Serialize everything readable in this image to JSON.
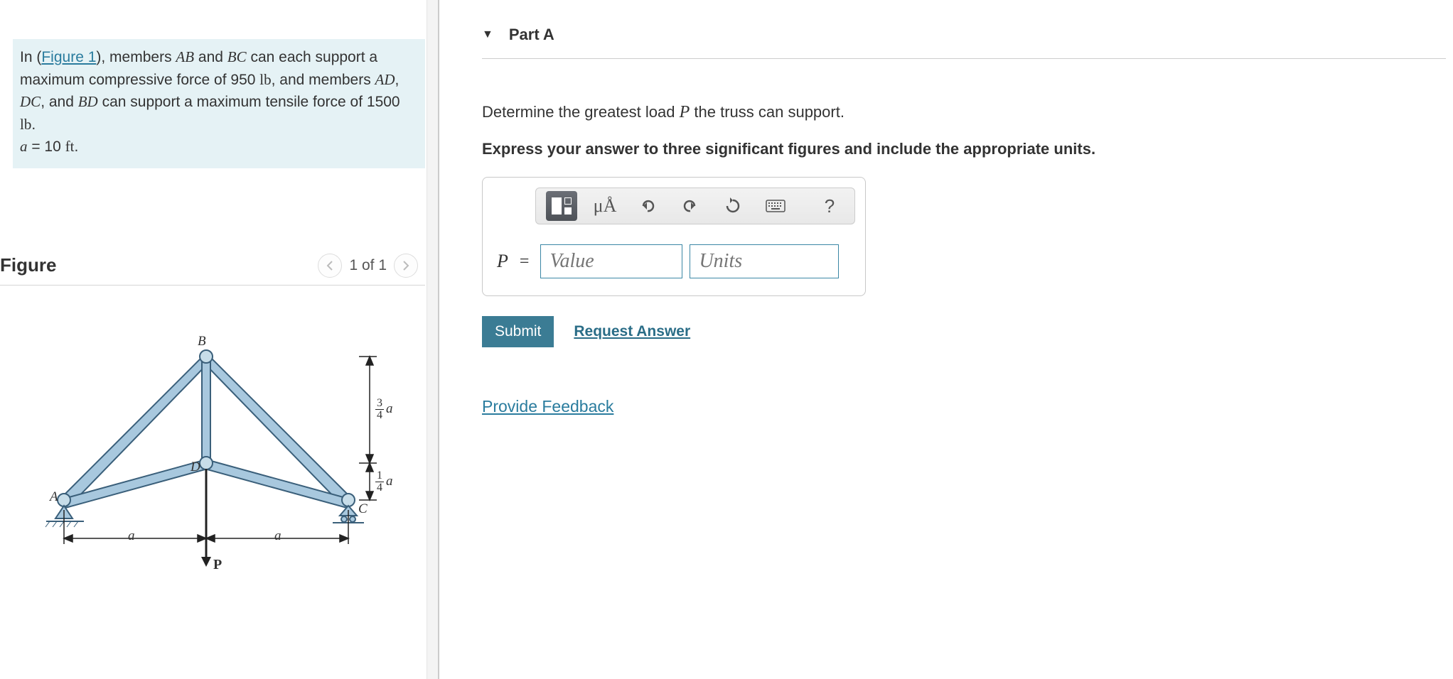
{
  "problem": {
    "prefix": "In (",
    "figure_link": "Figure 1",
    "text_after_link": "), members ",
    "m1": "AB",
    "t2": " and ",
    "m2": "BC",
    "t3": " can each support a maximum compressive force of 950 ",
    "unit1": "lb",
    "t4": ", and members ",
    "m3": "AD",
    "t5": ", ",
    "m4": "DC",
    "t6": ", and ",
    "m5": "BD",
    "t7": " can support a maximum tensile force of 1500 ",
    "unit2": "lb",
    "t8": ". ",
    "eq_var": "a",
    "eq_val": " = 10 ",
    "eq_unit": "ft",
    "eq_end": "."
  },
  "figure": {
    "title": "Figure",
    "page": "1 of 1",
    "labels": {
      "A": "A",
      "B": "B",
      "C": "C",
      "D": "D",
      "P": "P",
      "a": "a"
    },
    "dim_top": {
      "num": "3",
      "den": "4"
    },
    "dim_bot": {
      "num": "1",
      "den": "4"
    }
  },
  "part": {
    "title": "Part A",
    "question_pre": "Determine the greatest load ",
    "question_var": "P",
    "question_post": " the truss can support.",
    "instruction": "Express your answer to three significant figures and include the appropriate units."
  },
  "toolbar": {
    "mua": "μÅ",
    "help": "?"
  },
  "answer": {
    "var": "P",
    "equals": "=",
    "value_ph": "Value",
    "units_ph": "Units"
  },
  "buttons": {
    "submit": "Submit",
    "request": "Request Answer",
    "feedback": "Provide Feedback"
  }
}
